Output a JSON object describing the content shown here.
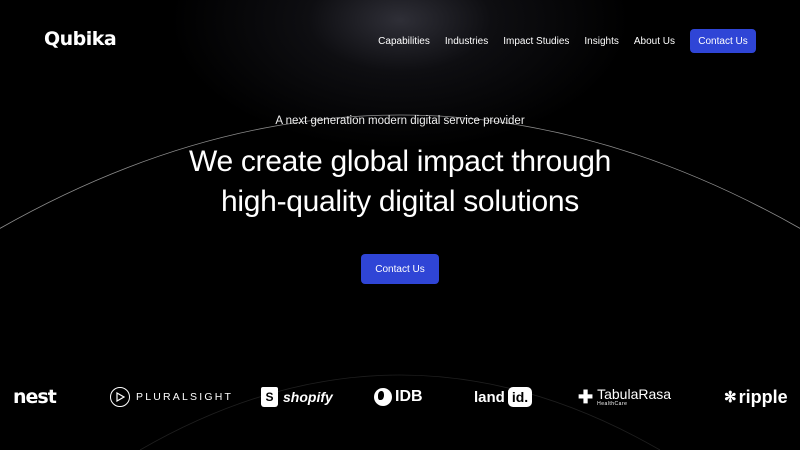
{
  "header": {
    "logo": "Qubika",
    "nav": [
      "Capabilities",
      "Industries",
      "Impact Studies",
      "Insights",
      "About Us"
    ],
    "cta_label": "Contact Us"
  },
  "hero": {
    "tagline": "A next generation modern digital service provider",
    "headline_line1": "We create global impact through",
    "headline_line2": "high-quality digital solutions",
    "cta_label": "Contact Us"
  },
  "clients": {
    "nest": "nest",
    "pluralsight": "PLURALSIGHT",
    "shopify": "shopify",
    "shopify_mark": "S",
    "idb": "IDB",
    "land": "land",
    "id": "id.",
    "tabularasa": "TabulaRasa",
    "tabularasa_sub": "HealthCare",
    "ripple": "ripple"
  },
  "colors": {
    "accent": "#2f45d6",
    "background": "#000000"
  }
}
